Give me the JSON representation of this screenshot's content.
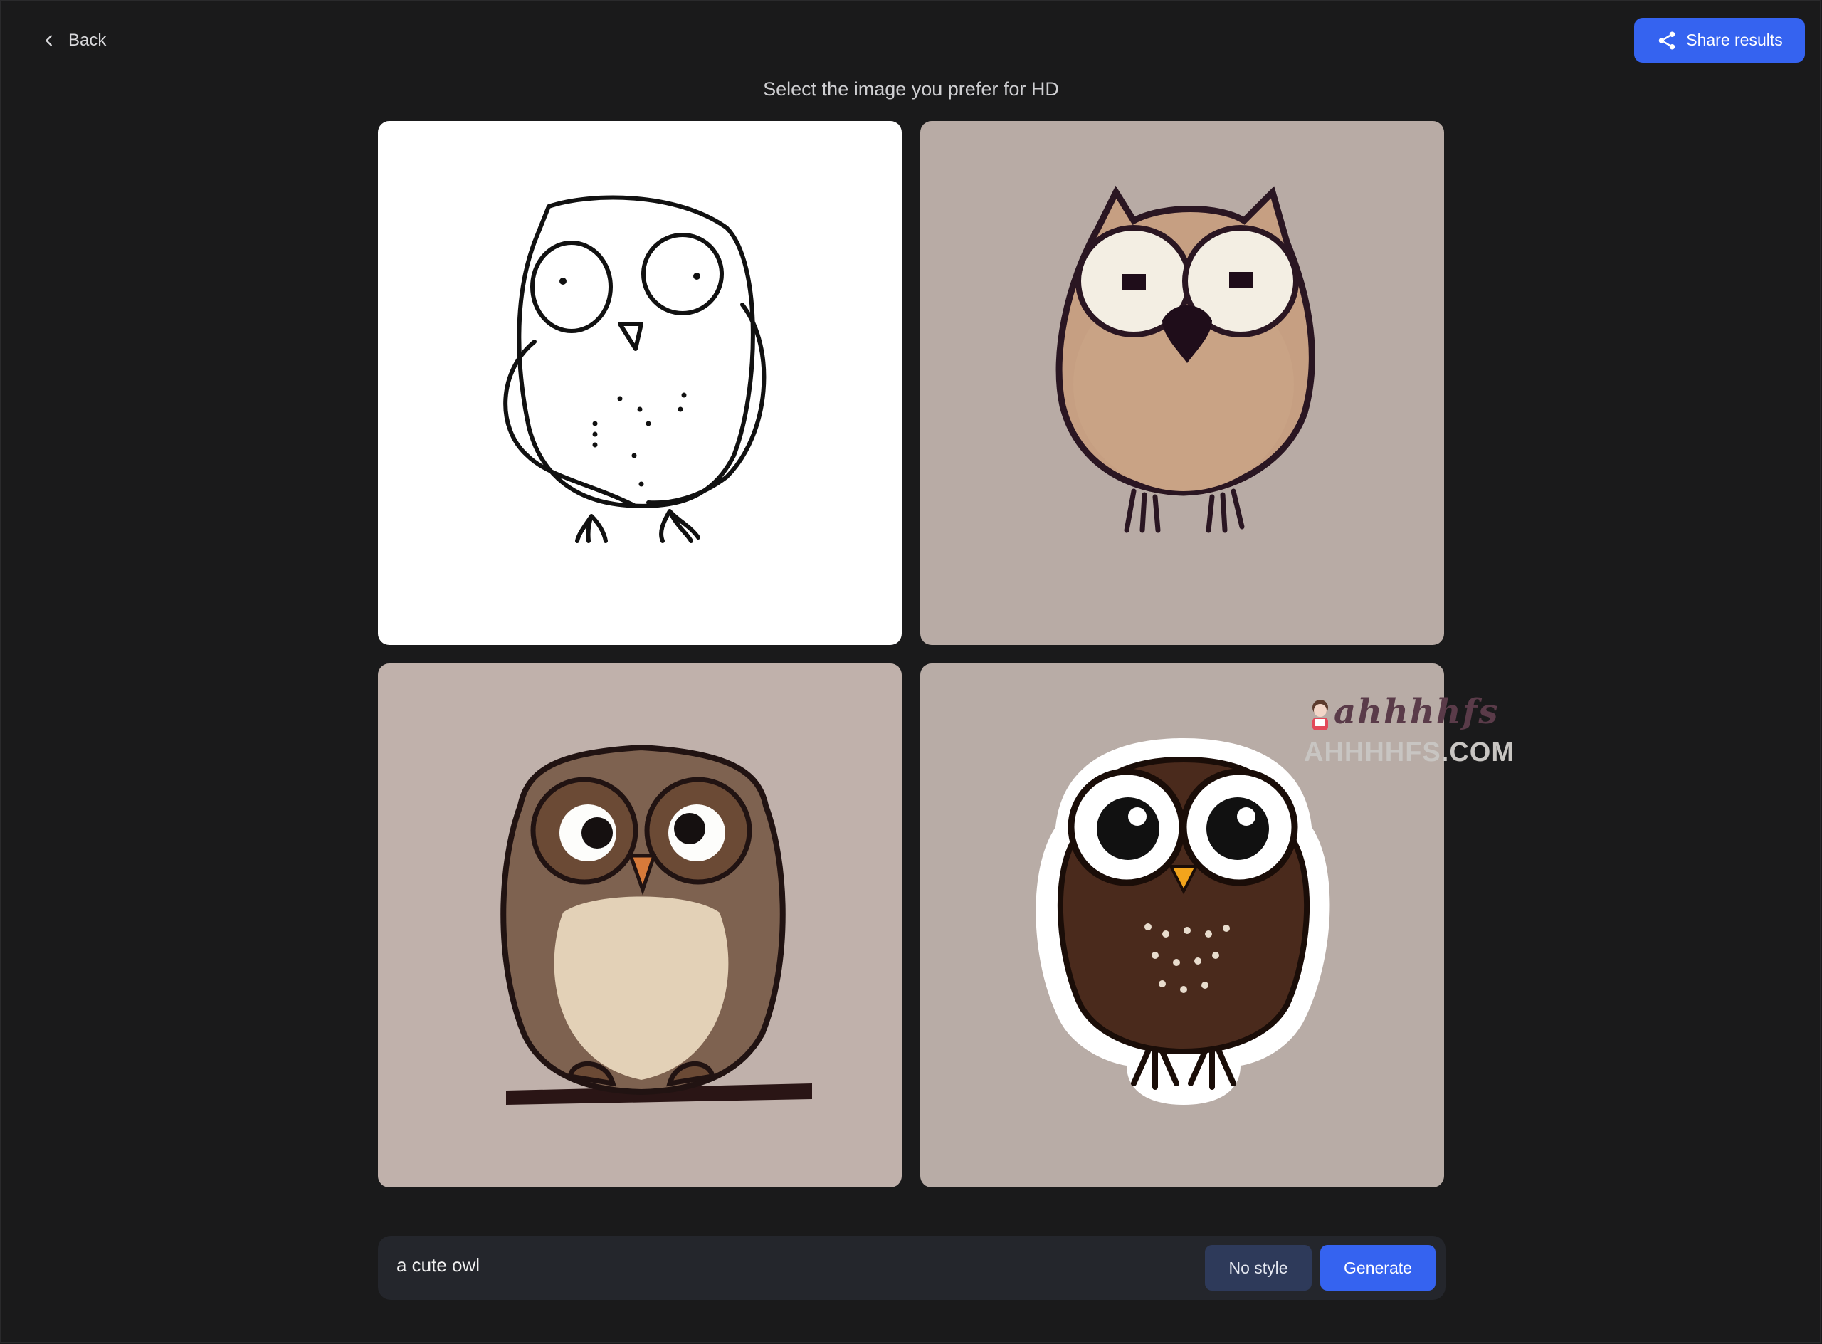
{
  "header": {
    "back_label": "Back",
    "share_label": "Share results",
    "title": "Select the image you prefer for HD"
  },
  "images": [
    {
      "id": "owl-line-sketch",
      "description_icon": "owl-image"
    },
    {
      "id": "owl-tan-outline",
      "description_icon": "owl-image"
    },
    {
      "id": "owl-branch",
      "description_icon": "owl-image"
    },
    {
      "id": "owl-sticker",
      "description_icon": "owl-image"
    }
  ],
  "watermark": {
    "top_text": "ahhhhfs",
    "bottom_text": "AHHHHFS.COM"
  },
  "prompt": {
    "value": "a cute owl",
    "style_label": "No style",
    "generate_label": "Generate"
  },
  "colors": {
    "background": "#1a1a1b",
    "accent": "#3563f0",
    "style_button": "#2e3a5a",
    "prompt_bar": "#24262c"
  }
}
